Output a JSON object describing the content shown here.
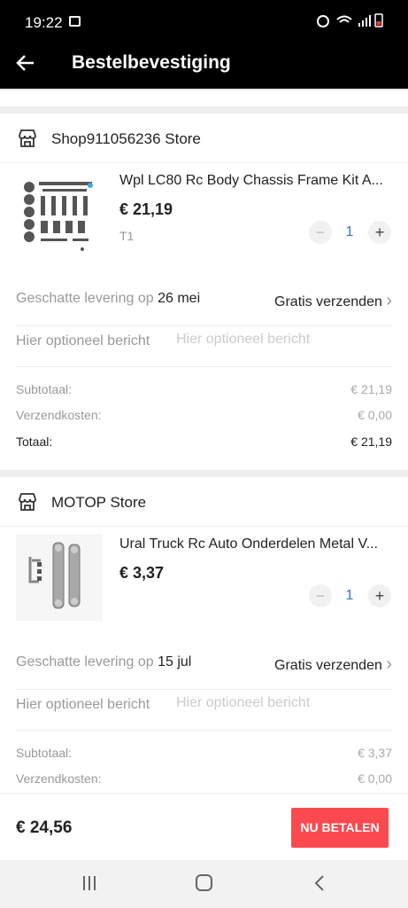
{
  "status_bar": {
    "time": "19:22",
    "icons": [
      "gallery-icon",
      "alarm-icon",
      "wifi-icon",
      "signal-icon",
      "battery-icon"
    ]
  },
  "app_bar": {
    "title": "Bestelbevestiging",
    "back_icon": "arrow-left-icon"
  },
  "stores": [
    {
      "name": "Shop911056236 Store",
      "product": {
        "title": "Wpl LC80 Rc Body Chassis Frame Kit A...",
        "price": "€ 21,19",
        "variant": "T1",
        "quantity": "1"
      },
      "delivery": {
        "label": "Geschatte levering op ",
        "date": "26 mei",
        "shipping": "Gratis verzenden"
      },
      "message": {
        "label": "Hier optioneel bericht",
        "placeholder": "Hier optioneel bericht"
      },
      "summary": {
        "subtotal_label": "Subtotaal:",
        "subtotal": "€ 21,19",
        "shipping_label": "Verzendkosten:",
        "shipping_cost": "€ 0,00",
        "total_label": "Totaal:",
        "total": "€ 21,19"
      }
    },
    {
      "name": "MOTOP Store",
      "product": {
        "title": "Ural Truck Rc Auto Onderdelen Metal V...",
        "price": "€ 3,37",
        "variant": "",
        "quantity": "1"
      },
      "delivery": {
        "label": "Geschatte levering op ",
        "date": "15 jul",
        "shipping": "Gratis verzenden"
      },
      "message": {
        "label": "Hier optioneel bericht",
        "placeholder": "Hier optioneel bericht"
      },
      "summary": {
        "subtotal_label": "Subtotaal:",
        "subtotal": "€ 3,37",
        "shipping_label": "Verzendkosten:",
        "shipping_cost": "€ 0,00"
      }
    }
  ],
  "qty_controls": {
    "minus": "−",
    "plus": "+"
  },
  "chevron": "›",
  "footer": {
    "total": "€ 24,56",
    "pay_button": "NU BETALEN"
  },
  "colors": {
    "accent": "#fb4a4f",
    "qty_blue": "#2a7bd4",
    "bar_black": "#000000"
  }
}
